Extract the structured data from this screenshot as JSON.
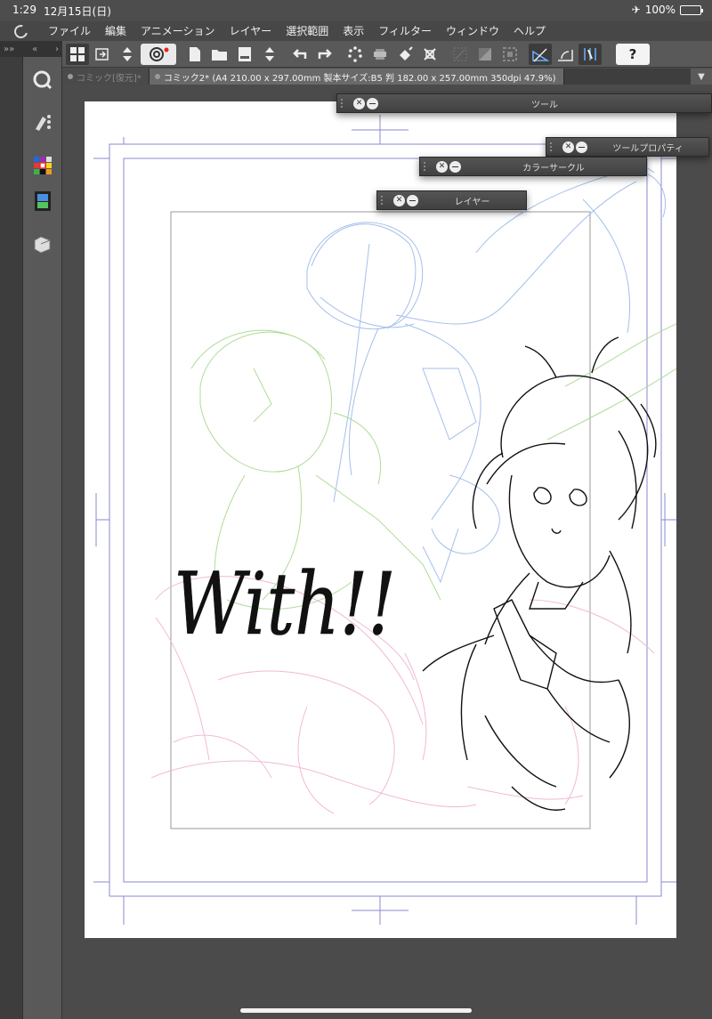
{
  "status_bar": {
    "time": "1:29",
    "date": "12月15日(日)",
    "battery": "100%",
    "battery_level": 1.0
  },
  "menu": {
    "items": [
      "ファイル",
      "編集",
      "アニメーション",
      "レイヤー",
      "選択範囲",
      "表示",
      "フィルター",
      "ウィンドウ",
      "ヘルプ"
    ]
  },
  "tabs": [
    {
      "label": "コミック[復元]*",
      "active": false
    },
    {
      "label": "コミック2* (A4 210.00 x 297.00mm 製本サイズ:B5 判 182.00 x 257.00mm 350dpi 47.9%)",
      "active": true
    }
  ],
  "palettes": {
    "tool": "ツール",
    "tool_property": "ツールプロパティ",
    "color_circle": "カラーサークル",
    "layer": "レイヤー"
  },
  "toolbar": {
    "help_label": "?"
  },
  "artwork": {
    "lettering": "With!!"
  },
  "colors": {
    "sketch_blue": "#9bb9e8",
    "sketch_green": "#a6d98e",
    "sketch_pink": "#f0b6d6",
    "guide_lines": "#8a8ad0"
  }
}
